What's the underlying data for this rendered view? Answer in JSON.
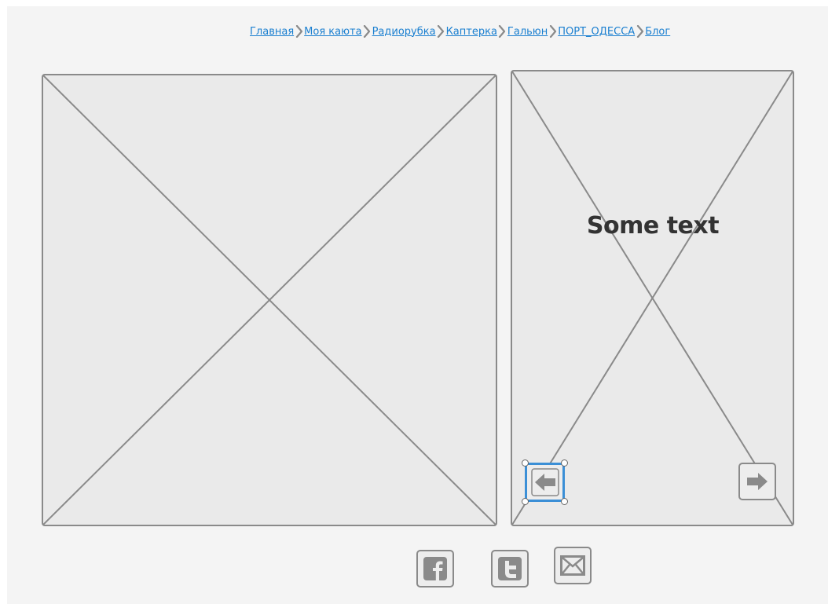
{
  "breadcrumb": {
    "items": [
      {
        "label": "Главная"
      },
      {
        "label": "Моя каюта"
      },
      {
        "label": "Радиорубка"
      },
      {
        "label": "Каптерка"
      },
      {
        "label": "Гальюн"
      },
      {
        "label": "ПОРТ_ОДЕССА"
      },
      {
        "label": "Блог"
      }
    ],
    "separator_icon": "chevron-right-icon"
  },
  "slider": {
    "caption": "Some text",
    "prev_icon": "arrow-left-icon",
    "next_icon": "arrow-right-icon"
  },
  "social": {
    "icons": [
      "facebook-icon",
      "twitter-icon",
      "mail-icon"
    ]
  },
  "colors": {
    "link": "#1a7fd0",
    "border": "#8a8a8a",
    "placeholder_fill": "#eaeaea",
    "selection": "#3b8fd6",
    "text": "#333333"
  }
}
